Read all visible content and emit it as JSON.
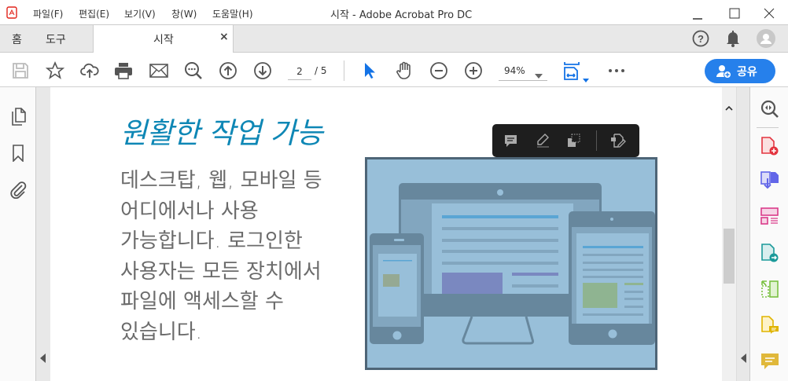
{
  "window": {
    "title": "시작 - Adobe Acrobat Pro DC"
  },
  "menu": [
    "파일(F)",
    "편집(E)",
    "보기(V)",
    "창(W)",
    "도움말(H)"
  ],
  "tabs": {
    "home": "홈",
    "tools": "도구",
    "document": "시작"
  },
  "toolbar": {
    "page_current": "2",
    "page_total": "/ 5",
    "zoom": "94%",
    "share_label": "공유"
  },
  "document": {
    "heading": "원활한 작업 가능",
    "body_lines": [
      "데스크탑, 웹, 모바일 등",
      "어디에서나 사용",
      "가능합니다. 로그인한",
      "사용자는 모든 장치에서",
      "파일에 액세스할 수",
      "있습니다."
    ]
  },
  "colors": {
    "accent": "#2680eb",
    "heading": "#0e87b5",
    "illustration_bg": "#98bfd9"
  }
}
